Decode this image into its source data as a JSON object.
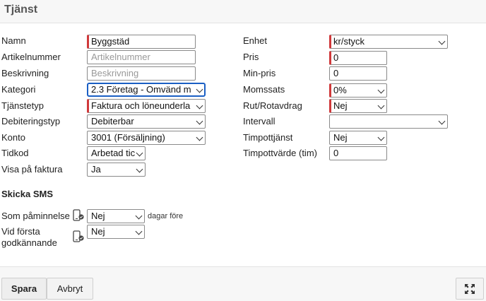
{
  "header": {
    "title": "Tjänst"
  },
  "left": {
    "name": {
      "label": "Namn",
      "value": "Byggstäd"
    },
    "article_number": {
      "label": "Artikelnummer",
      "placeholder": "Artikelnummer"
    },
    "description": {
      "label": "Beskrivning",
      "placeholder": "Beskrivning"
    },
    "category": {
      "label": "Kategori",
      "value": "2.3 Företag - Omvänd m"
    },
    "service_type": {
      "label": "Tjänstetyp",
      "value": "Faktura och löneunderla"
    },
    "debit_type": {
      "label": "Debiteringstyp",
      "value": "Debiterbar"
    },
    "account": {
      "label": "Konto",
      "value": "3001 (Försäljning)"
    },
    "time_code": {
      "label": "Tidkod",
      "value": "Arbetad tic"
    },
    "show_on_invoice": {
      "label": "Visa på faktura",
      "value": "Ja"
    }
  },
  "right": {
    "unit": {
      "label": "Enhet",
      "value": "kr/styck"
    },
    "price": {
      "label": "Pris",
      "value": "0"
    },
    "min_price": {
      "label": "Min-pris",
      "value": "0"
    },
    "vat": {
      "label": "Momssats",
      "value": "0%"
    },
    "rut_rot": {
      "label": "Rut/Rotavdrag",
      "value": "Nej"
    },
    "interval": {
      "label": "Intervall",
      "value": ""
    },
    "hourly_service": {
      "label": "Timpottjänst",
      "value": "Nej"
    },
    "hourly_value": {
      "label": "Timpottvärde (tim)",
      "value": "0"
    }
  },
  "sms": {
    "section_title": "Skicka SMS",
    "reminder": {
      "label": "Som påminnelse",
      "value": "Nej",
      "suffix": "dagar före"
    },
    "first_approval": {
      "label_line1": "Vid första",
      "label_line2": "godkännande",
      "value": "Nej"
    }
  },
  "footer": {
    "save_label": "Spara",
    "cancel_label": "Avbryt"
  },
  "colors": {
    "required_marker": "#d0393b",
    "focus_border": "#1a5fc4"
  }
}
